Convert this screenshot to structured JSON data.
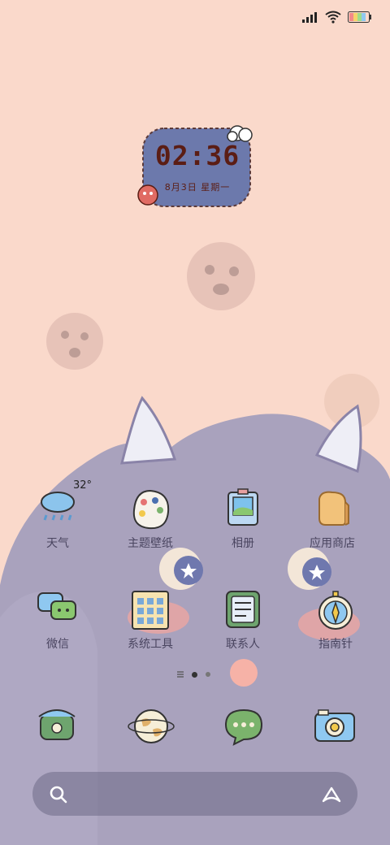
{
  "status_bar": {
    "icons": [
      "signal-icon",
      "wifi-icon",
      "battery-icon"
    ]
  },
  "clock_widget": {
    "time": "02:36",
    "date": "8月3日 星期一"
  },
  "weather": {
    "temperature": "32°"
  },
  "apps_row1": [
    {
      "label": "天气",
      "icon": "weather-icon"
    },
    {
      "label": "主题壁纸",
      "icon": "palette-icon"
    },
    {
      "label": "相册",
      "icon": "photo-icon"
    },
    {
      "label": "应用商店",
      "icon": "bread-icon"
    }
  ],
  "apps_row2": [
    {
      "label": "微信",
      "icon": "chat-bubbles-icon"
    },
    {
      "label": "系统工具",
      "icon": "calendar-board-icon"
    },
    {
      "label": "联系人",
      "icon": "contacts-icon"
    },
    {
      "label": "指南针",
      "icon": "compass-icon"
    }
  ],
  "dock": [
    {
      "icon": "phone-icon"
    },
    {
      "icon": "globe-icon"
    },
    {
      "icon": "message-icon"
    },
    {
      "icon": "camera-icon"
    }
  ],
  "pager": {
    "pages": 2,
    "current": 1
  },
  "colors": {
    "background": "#fad9cb",
    "monster": "#a39cb8",
    "clock_frame": "#6c79ac",
    "label_text": "#4a4560"
  }
}
